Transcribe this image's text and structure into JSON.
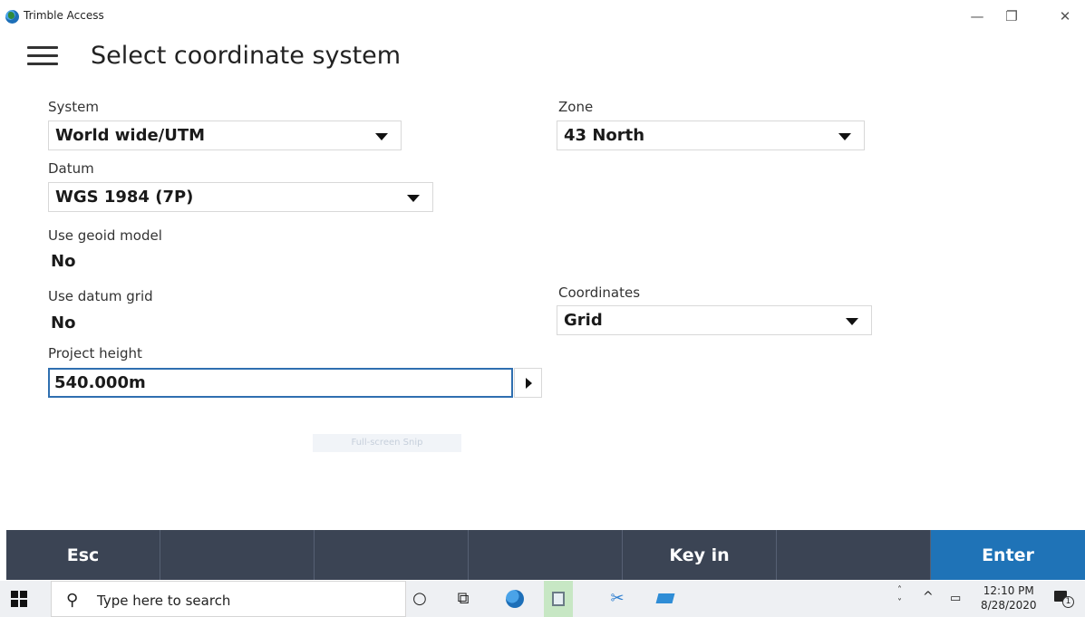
{
  "window": {
    "title": "Trimble Access",
    "minimize_glyph": "—",
    "restore_glyph": "❐",
    "close_glyph": "✕"
  },
  "header": {
    "title": "Select coordinate system"
  },
  "form": {
    "system": {
      "label": "System",
      "value": "World wide/UTM"
    },
    "zone": {
      "label": "Zone",
      "value": "43 North"
    },
    "datum": {
      "label": "Datum",
      "value": "WGS 1984 (7P)"
    },
    "geoid": {
      "label": "Use geoid model",
      "value": "No"
    },
    "datum_grid": {
      "label": "Use datum grid",
      "value": "No"
    },
    "coordinates": {
      "label": "Coordinates",
      "value": "Grid"
    },
    "project_height": {
      "label": "Project height",
      "value": "540.000m"
    }
  },
  "snip_overlay": "Full-screen Snip",
  "softkeys": [
    "Esc",
    "",
    "",
    "",
    "Key in",
    "",
    "Enter"
  ],
  "taskbar": {
    "search_placeholder": "Type here to search",
    "time": "12:10 PM",
    "date": "8/28/2020",
    "notification_count": "1"
  },
  "colors": {
    "softkey_bar": "#3b4454",
    "enter_button": "#1f73b7",
    "input_focus_border": "#2f6fb0"
  }
}
